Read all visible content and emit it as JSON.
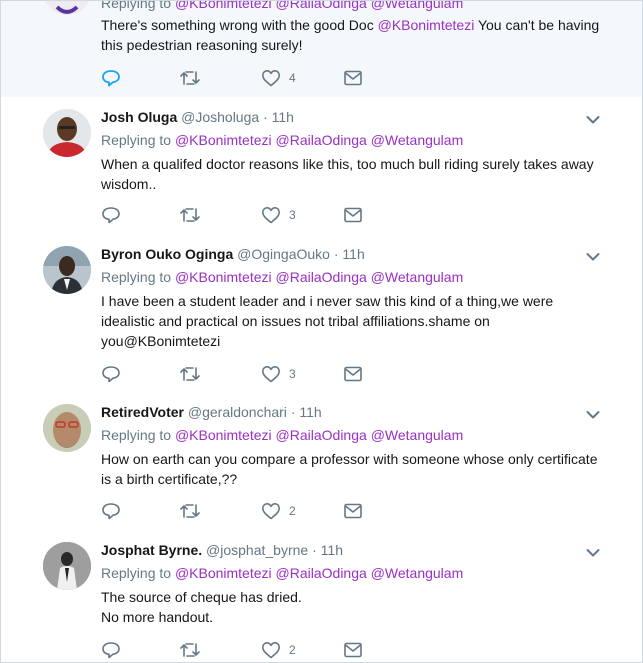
{
  "tweets": [
    {
      "name": "",
      "handle": "",
      "time": "",
      "replying_label": "Replying to",
      "mentions": [
        "@KBonimtetezi",
        "@RailaOdinga",
        "@Wetangulam"
      ],
      "text_before": "There's something wrong with the good Doc ",
      "text_mention": "@KBonimtetezi",
      "text_after": " You can't be having this pedestrian reasoning surely!",
      "likes": "4"
    },
    {
      "name": "Josh Oluga",
      "handle": "@Josholuga",
      "time": "11h",
      "replying_label": "Replying to",
      "mentions": [
        "@KBonimtetezi",
        "@RailaOdinga",
        "@Wetangulam"
      ],
      "text": "When a qualifed doctor reasons like this, too much bull riding surely takes away wisdom..",
      "likes": "3"
    },
    {
      "name": "Byron Ouko Oginga",
      "handle": "@OgingaOuko",
      "time": "11h",
      "replying_label": "Replying to",
      "mentions": [
        "@KBonimtetezi",
        "@RailaOdinga",
        "@Wetangulam"
      ],
      "text": "I have been a student leader and i never saw this kind of a thing,we were idealistic and practical on issues not tribal affiliations.shame on you@KBonimtetezi",
      "likes": "3"
    },
    {
      "name": "RetiredVoter",
      "handle": "@geraldonchari",
      "time": "11h",
      "replying_label": "Replying to",
      "mentions": [
        "@KBonimtetezi",
        "@RailaOdinga",
        "@Wetangulam"
      ],
      "text": "How on earth can you compare a professor with someone whose only certificate is a birth certificate,??",
      "likes": "2"
    },
    {
      "name": "Josphat Byrne.",
      "handle": "@josphat_byrne",
      "time": "11h",
      "replying_label": "Replying to",
      "mentions": [
        "@KBonimtetezi",
        "@RailaOdinga",
        "@Wetangulam"
      ],
      "text_line1": "The source of cheque has dried.",
      "text_line2": "No more handout.",
      "likes": "2"
    }
  ],
  "separator": "·",
  "colors": {
    "mention": "#9b30c4",
    "meta": "#657786",
    "reply_active": "#1da1f2",
    "border": "#e6ecf0"
  },
  "icons": [
    "reply-icon",
    "retweet-icon",
    "heart-icon",
    "envelope-icon",
    "chevron-down-icon"
  ]
}
